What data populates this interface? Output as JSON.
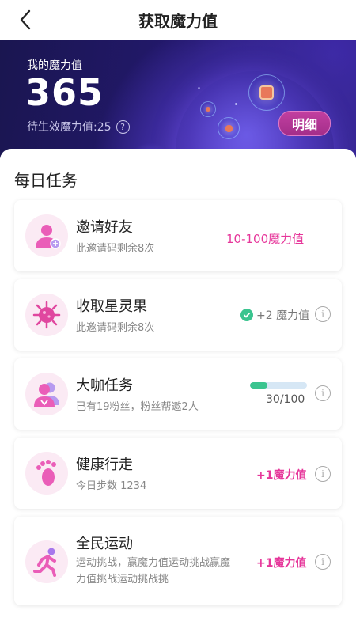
{
  "nav": {
    "title": "获取魔力值"
  },
  "banner": {
    "label": "我的魔力值",
    "value": "365",
    "pending": "待生效魔力值:25",
    "help_glyph": "?",
    "detail_button": "明细"
  },
  "section": {
    "title": "每日任务"
  },
  "tasks": [
    {
      "title": "邀请好友",
      "subtitle": "此邀请码剩余8次",
      "reward": "10-100魔力值",
      "icon": "invite-friend-icon"
    },
    {
      "title": "收取星灵果",
      "subtitle": "此邀请码剩余8次",
      "reward": "+2 魔力值",
      "icon": "star-fruit-icon",
      "completed": true
    },
    {
      "title": "大咖任务",
      "subtitle": "已有19粉丝，粉丝帮邀2人",
      "progress_text": "30/100",
      "progress": 0.3,
      "icon": "vip-task-icon"
    },
    {
      "title": "健康行走",
      "subtitle": "今日步数 1234",
      "reward": "+1魔力值",
      "icon": "footprint-icon"
    },
    {
      "title": "全民运动",
      "subtitle": "运动挑战，赢魔力值运动挑战赢魔力值挑战运动挑战挑",
      "reward": "+1魔力值",
      "icon": "running-icon"
    }
  ],
  "colors": {
    "accent": "#e6369a",
    "success": "#3ac48f",
    "banner_bg": "#22186a"
  }
}
